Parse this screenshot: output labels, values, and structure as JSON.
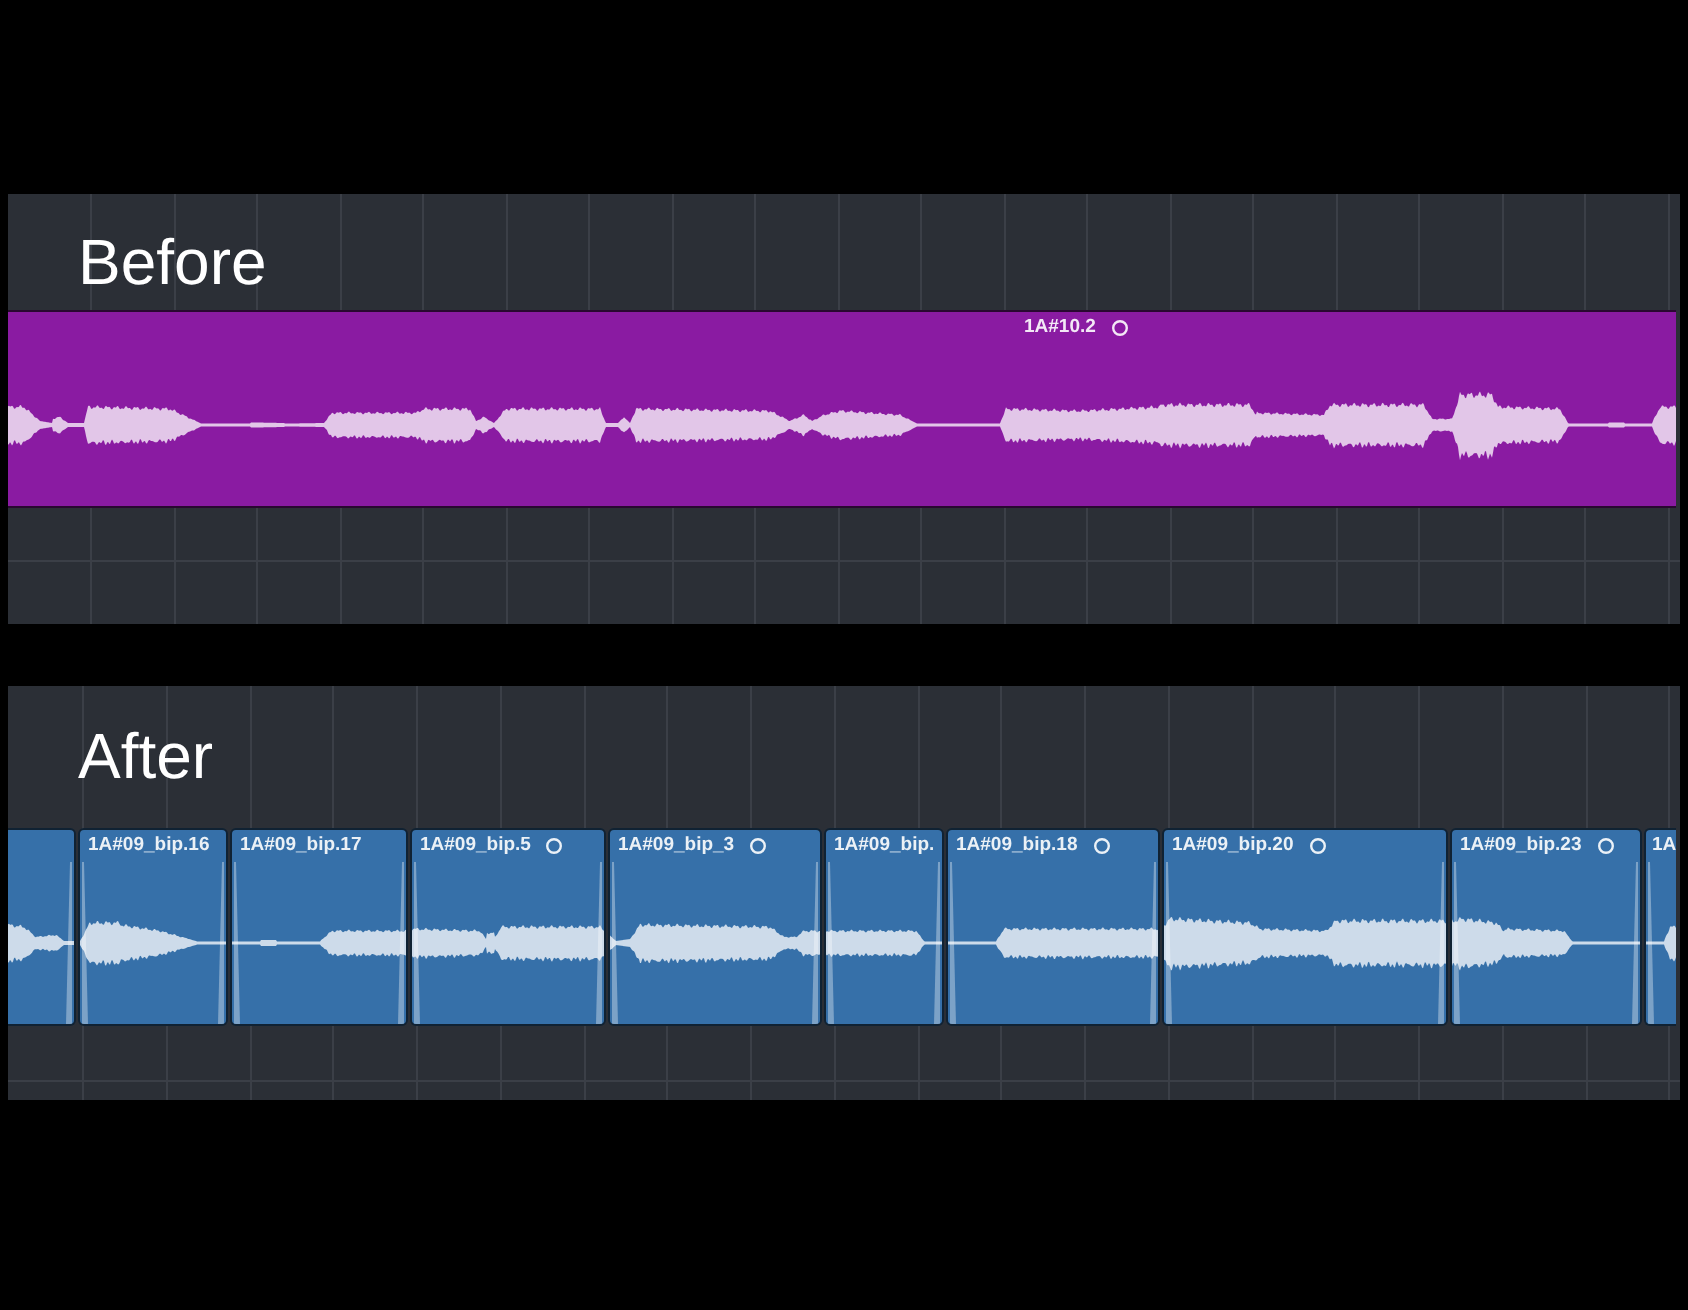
{
  "panels": [
    {
      "title": "Before",
      "color": "#8a1ba2",
      "regions": [
        {
          "label": "1A#10.2",
          "marked": true
        }
      ]
    },
    {
      "title": "After",
      "color": "#3670a9",
      "regions": [
        {
          "marked": false
        },
        {
          "label": "1A#09_bip.16",
          "marked": false
        },
        {
          "label": "1A#09_bip.17",
          "marked": false
        },
        {
          "label": "1A#09_bip.5",
          "marked": true
        },
        {
          "label": "1A#09_bip_3",
          "marked": true
        },
        {
          "label": "1A#09_bip.",
          "marked": false
        },
        {
          "label": "1A#09_bip.18",
          "marked": true
        },
        {
          "label": "1A#09_bip.20",
          "marked": true
        },
        {
          "label": "1A#09_bip.23",
          "marked": true
        },
        {
          "label": "1A",
          "marked": false
        }
      ]
    }
  ]
}
